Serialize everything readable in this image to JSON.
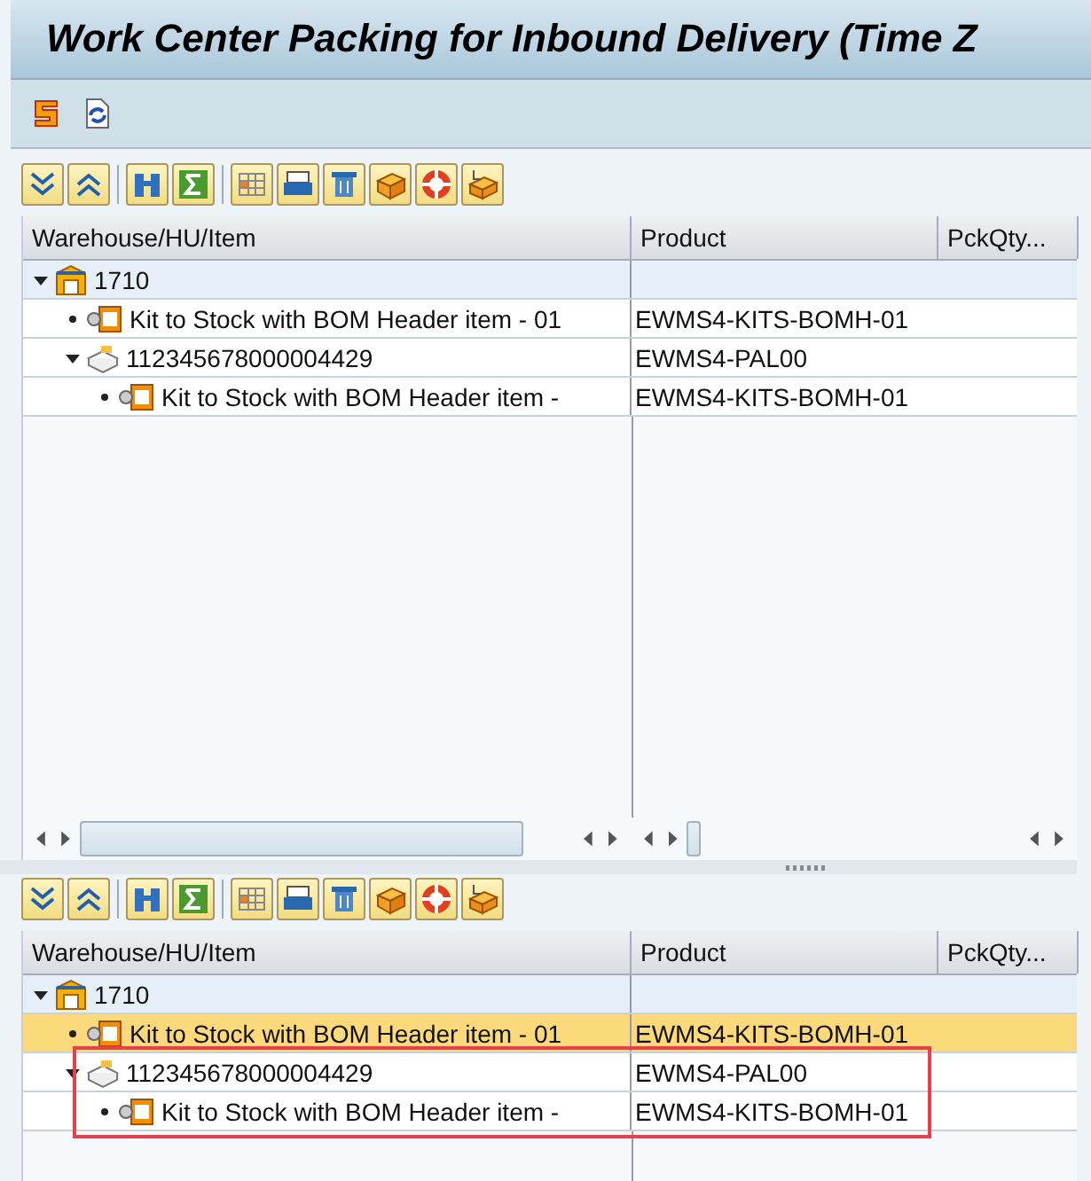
{
  "window": {
    "title": "Work Center Packing for Inbound Delivery (Time Z"
  },
  "upper_tree": {
    "columns": [
      "Warehouse/HU/Item",
      "Product",
      "PckQty..."
    ],
    "rows": [
      {
        "kind": "warehouse",
        "label": "1710",
        "product": "",
        "expanded": true,
        "selected": false,
        "children": [
          {
            "kind": "item",
            "label": "Kit to Stock with BOM Header item - 01",
            "product": "EWMS4-KITS-BOMH-01",
            "selected": false
          },
          {
            "kind": "hu",
            "label": "112345678000004429",
            "product": "EWMS4-PAL00",
            "expanded": true,
            "selected": false,
            "children": [
              {
                "kind": "item",
                "label": "Kit to Stock with BOM Header item -",
                "product": "EWMS4-KITS-BOMH-01",
                "selected": false
              }
            ]
          }
        ]
      }
    ]
  },
  "lower_tree": {
    "columns": [
      "Warehouse/HU/Item",
      "Product",
      "PckQty..."
    ],
    "rows": [
      {
        "kind": "warehouse",
        "label": "1710",
        "product": "",
        "expanded": true,
        "selected": false,
        "children": [
          {
            "kind": "item",
            "label": "Kit to Stock with BOM Header item - 01",
            "product": "EWMS4-KITS-BOMH-01",
            "selected": true
          },
          {
            "kind": "hu",
            "label": "112345678000004429",
            "product": "EWMS4-PAL00",
            "expanded": true,
            "selected": false,
            "boxed": true,
            "children": [
              {
                "kind": "item",
                "label": "Kit to Stock with BOM Header item -",
                "product": "EWMS4-KITS-BOMH-01",
                "selected": false,
                "boxed": true
              }
            ]
          }
        ]
      }
    ]
  }
}
